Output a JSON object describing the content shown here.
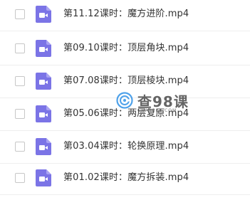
{
  "file_list": {
    "items": [
      {
        "name": "第11.12课时：魔方进阶.mp4",
        "icon": "video-file-icon",
        "checked": false
      },
      {
        "name": "第09.10课时：顶层角块.mp4",
        "icon": "video-file-icon",
        "checked": false
      },
      {
        "name": "第07.08课时：顶层棱块.mp4",
        "icon": "video-file-icon",
        "checked": false
      },
      {
        "name": "第05.06课时：两层复原.mp4",
        "icon": "video-file-icon",
        "checked": false
      },
      {
        "name": "第03.04课时：轮换原理.mp4",
        "icon": "video-file-icon",
        "checked": false
      },
      {
        "name": "第01.02课时：魔方拆装.mp4",
        "icon": "video-file-icon",
        "checked": false
      }
    ]
  },
  "watermark": {
    "title": "查98课",
    "url": "CHA98KE.COM",
    "icon": "watermark-logo-icon"
  },
  "colors": {
    "video_icon": "#7b74e6",
    "text": "#333333",
    "divider": "#eeeeee",
    "checkbox_border": "#c7c7c7",
    "watermark_logo": "#1e88e5"
  }
}
